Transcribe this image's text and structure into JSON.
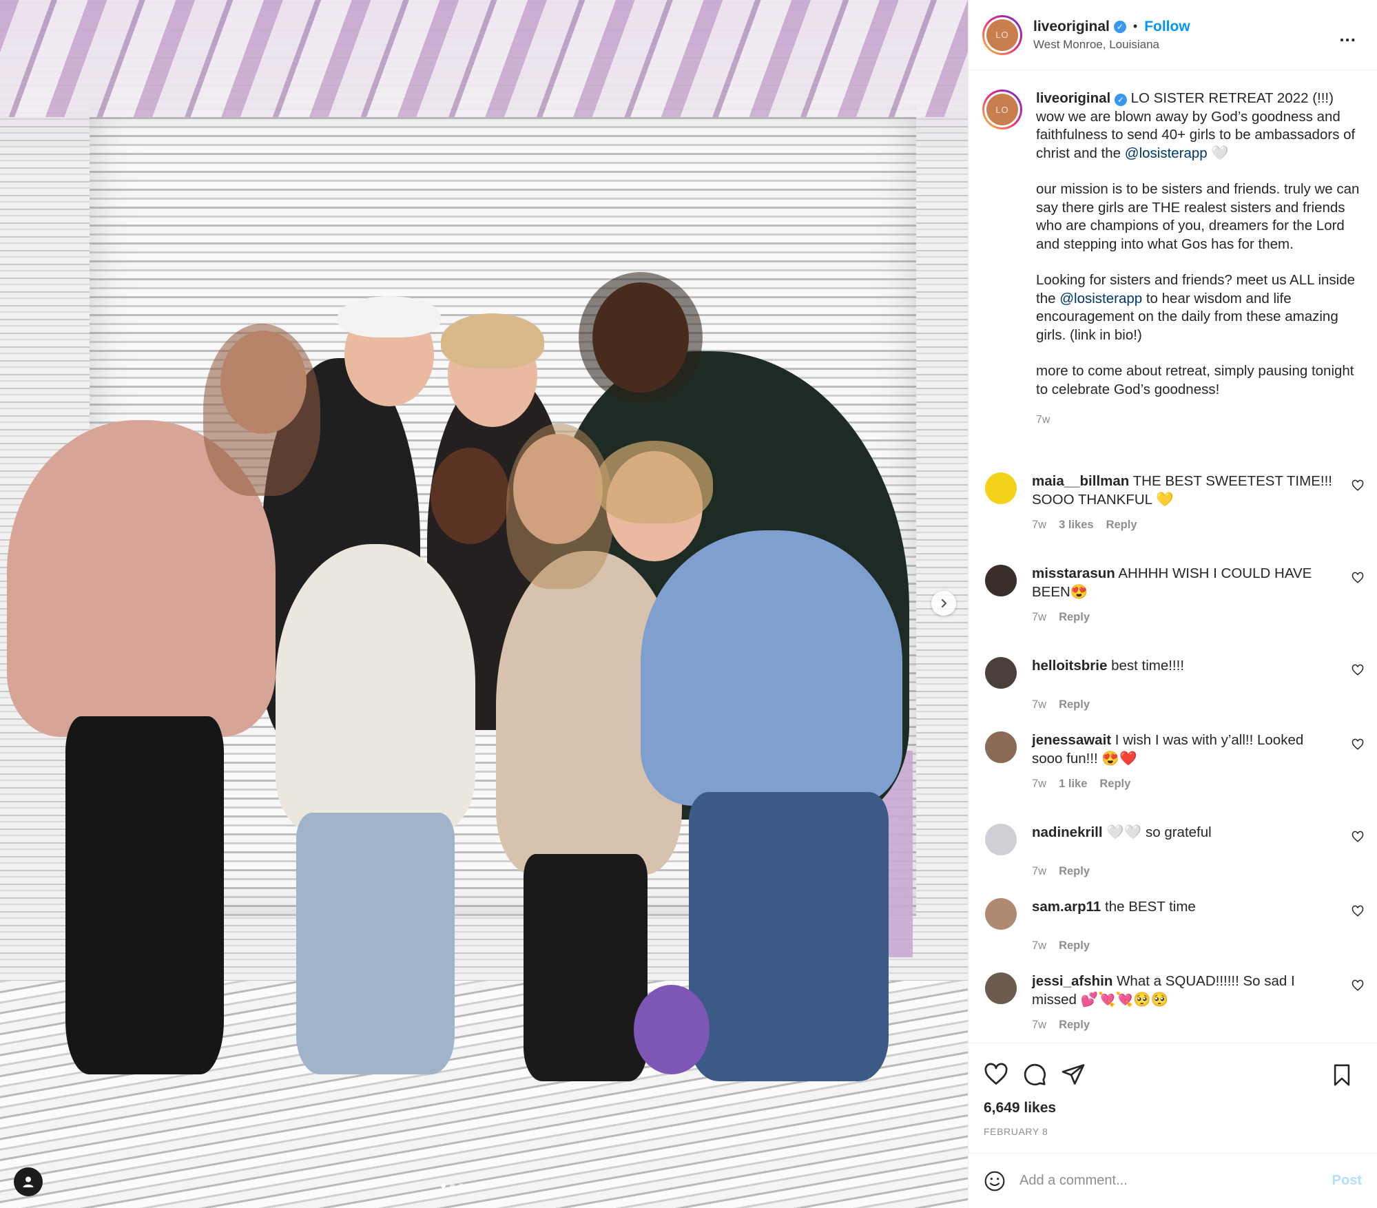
{
  "post": {
    "username": "liveoriginal",
    "verified": true,
    "follow_label": "Follow",
    "location": "West Monroe, Louisiana",
    "more_label": "...",
    "avatar_text": "LO",
    "separator": "•"
  },
  "caption": {
    "username": "liveoriginal",
    "p1_a": "LO SISTER RETREAT 2022 (!!!) wow we are blown away by God’s goodness and faithfulness to send 40+ girls to be ambassadors of christ and the ",
    "p1_mention": "@losisterapp",
    "p1_emoji": "🤍",
    "p2": "our mission is to be sisters and friends. truly we can say there girls are THE realest sisters and friends who are champions of you, dreamers for the Lord and stepping into what Gos has for them.",
    "p3_a": "Looking for sisters and friends? meet us ALL inside the ",
    "p3_mention": "@losisterapp",
    "p3_b": " to hear wisdom and life encouragement on the daily from these amazing girls. (link in bio!)",
    "p4": "more to come about retreat, simply pausing tonight to celebrate God’s goodness!",
    "time": "7w"
  },
  "comments": [
    {
      "user": "maia__billman",
      "text": "THE BEST SWEETEST TIME!!! SOOO THANKFUL 💛",
      "time": "7w",
      "likes": "3 likes",
      "reply": "Reply",
      "avatar_color": "#f2d21a"
    },
    {
      "user": "misstarasun",
      "text": "AHHHH WISH I COULD HAVE BEEN😍",
      "time": "7w",
      "likes": "",
      "reply": "Reply",
      "avatar_color": "#3a2e2a"
    },
    {
      "user": "helloitsbrie",
      "text": "best time!!!!",
      "time": "7w",
      "likes": "",
      "reply": "Reply",
      "avatar_color": "#4a3f3a"
    },
    {
      "user": "jenessawait",
      "text": "I wish I was with y’all!! Looked sooo fun!!! 😍❤️",
      "time": "7w",
      "likes": "1 like",
      "reply": "Reply",
      "avatar_color": "#8a6a55"
    },
    {
      "user": "nadinekrill",
      "text": "🤍🤍 so grateful",
      "time": "7w",
      "likes": "",
      "reply": "Reply",
      "avatar_color": "#cfcfd6"
    },
    {
      "user": "sam.arp11",
      "text": "the BEST time",
      "time": "7w",
      "likes": "",
      "reply": "Reply",
      "avatar_color": "#b08a70"
    },
    {
      "user": "jessi_afshin",
      "text": "What a SQUAD!!!!!! So sad I missed 💕💘💘🥺🥺",
      "time": "7w",
      "likes": "",
      "reply": "Reply",
      "avatar_color": "#6b5a4e"
    }
  ],
  "actions": {
    "likes": "6,649 likes",
    "date": "FEBRUARY 8",
    "icons": [
      "heart-icon",
      "comment-icon",
      "share-icon",
      "bookmark-icon"
    ]
  },
  "add_comment": {
    "placeholder": "Add a comment...",
    "post_label": "Post"
  },
  "colors": {
    "link": "#0095f6",
    "mention": "#00376b",
    "muted": "#8e8e8e",
    "post_disabled": "#b2dffc"
  }
}
